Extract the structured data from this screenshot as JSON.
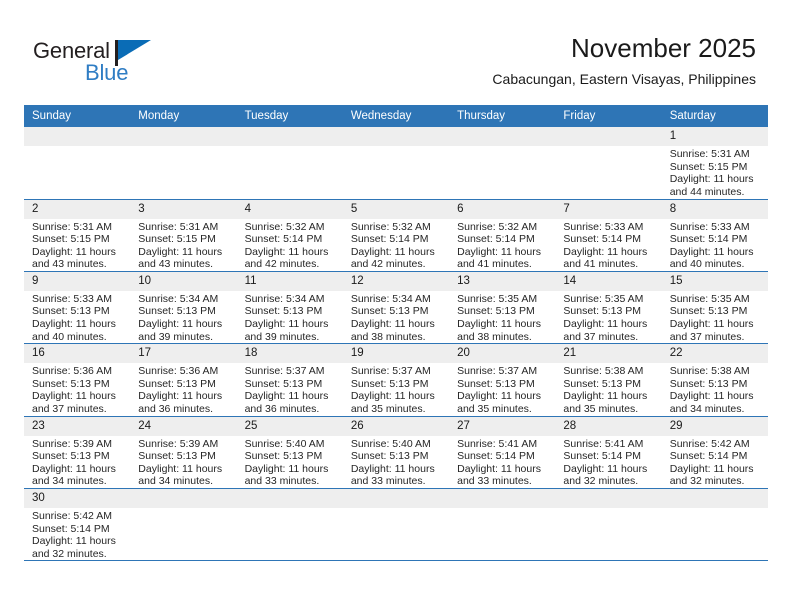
{
  "brand": {
    "name_dark": "General",
    "name_blue": "Blue",
    "flag_color": "#0a6cb6",
    "blue_text_color": "#2f7dc4"
  },
  "header": {
    "title": "November 2025",
    "subtitle": "Cabacungan, Eastern Visayas, Philippines"
  },
  "theme": {
    "header_bg": "#2e75b6",
    "header_text": "#ffffff",
    "daynum_band_bg": "#eeeeee",
    "row_divider": "#2e75b6",
    "body_text": "#262626"
  },
  "weekday_headers": [
    "Sunday",
    "Monday",
    "Tuesday",
    "Wednesday",
    "Thursday",
    "Friday",
    "Saturday"
  ],
  "weeks": [
    [
      {
        "empty": true
      },
      {
        "empty": true
      },
      {
        "empty": true
      },
      {
        "empty": true
      },
      {
        "empty": true
      },
      {
        "empty": true
      },
      {
        "day": "1",
        "sunrise": "Sunrise: 5:31 AM",
        "sunset": "Sunset: 5:15 PM",
        "daylight_line1": "Daylight: 11 hours",
        "daylight_line2": "and 44 minutes."
      }
    ],
    [
      {
        "day": "2",
        "sunrise": "Sunrise: 5:31 AM",
        "sunset": "Sunset: 5:15 PM",
        "daylight_line1": "Daylight: 11 hours",
        "daylight_line2": "and 43 minutes."
      },
      {
        "day": "3",
        "sunrise": "Sunrise: 5:31 AM",
        "sunset": "Sunset: 5:15 PM",
        "daylight_line1": "Daylight: 11 hours",
        "daylight_line2": "and 43 minutes."
      },
      {
        "day": "4",
        "sunrise": "Sunrise: 5:32 AM",
        "sunset": "Sunset: 5:14 PM",
        "daylight_line1": "Daylight: 11 hours",
        "daylight_line2": "and 42 minutes."
      },
      {
        "day": "5",
        "sunrise": "Sunrise: 5:32 AM",
        "sunset": "Sunset: 5:14 PM",
        "daylight_line1": "Daylight: 11 hours",
        "daylight_line2": "and 42 minutes."
      },
      {
        "day": "6",
        "sunrise": "Sunrise: 5:32 AM",
        "sunset": "Sunset: 5:14 PM",
        "daylight_line1": "Daylight: 11 hours",
        "daylight_line2": "and 41 minutes."
      },
      {
        "day": "7",
        "sunrise": "Sunrise: 5:33 AM",
        "sunset": "Sunset: 5:14 PM",
        "daylight_line1": "Daylight: 11 hours",
        "daylight_line2": "and 41 minutes."
      },
      {
        "day": "8",
        "sunrise": "Sunrise: 5:33 AM",
        "sunset": "Sunset: 5:14 PM",
        "daylight_line1": "Daylight: 11 hours",
        "daylight_line2": "and 40 minutes."
      }
    ],
    [
      {
        "day": "9",
        "sunrise": "Sunrise: 5:33 AM",
        "sunset": "Sunset: 5:13 PM",
        "daylight_line1": "Daylight: 11 hours",
        "daylight_line2": "and 40 minutes."
      },
      {
        "day": "10",
        "sunrise": "Sunrise: 5:34 AM",
        "sunset": "Sunset: 5:13 PM",
        "daylight_line1": "Daylight: 11 hours",
        "daylight_line2": "and 39 minutes."
      },
      {
        "day": "11",
        "sunrise": "Sunrise: 5:34 AM",
        "sunset": "Sunset: 5:13 PM",
        "daylight_line1": "Daylight: 11 hours",
        "daylight_line2": "and 39 minutes."
      },
      {
        "day": "12",
        "sunrise": "Sunrise: 5:34 AM",
        "sunset": "Sunset: 5:13 PM",
        "daylight_line1": "Daylight: 11 hours",
        "daylight_line2": "and 38 minutes."
      },
      {
        "day": "13",
        "sunrise": "Sunrise: 5:35 AM",
        "sunset": "Sunset: 5:13 PM",
        "daylight_line1": "Daylight: 11 hours",
        "daylight_line2": "and 38 minutes."
      },
      {
        "day": "14",
        "sunrise": "Sunrise: 5:35 AM",
        "sunset": "Sunset: 5:13 PM",
        "daylight_line1": "Daylight: 11 hours",
        "daylight_line2": "and 37 minutes."
      },
      {
        "day": "15",
        "sunrise": "Sunrise: 5:35 AM",
        "sunset": "Sunset: 5:13 PM",
        "daylight_line1": "Daylight: 11 hours",
        "daylight_line2": "and 37 minutes."
      }
    ],
    [
      {
        "day": "16",
        "sunrise": "Sunrise: 5:36 AM",
        "sunset": "Sunset: 5:13 PM",
        "daylight_line1": "Daylight: 11 hours",
        "daylight_line2": "and 37 minutes."
      },
      {
        "day": "17",
        "sunrise": "Sunrise: 5:36 AM",
        "sunset": "Sunset: 5:13 PM",
        "daylight_line1": "Daylight: 11 hours",
        "daylight_line2": "and 36 minutes."
      },
      {
        "day": "18",
        "sunrise": "Sunrise: 5:37 AM",
        "sunset": "Sunset: 5:13 PM",
        "daylight_line1": "Daylight: 11 hours",
        "daylight_line2": "and 36 minutes."
      },
      {
        "day": "19",
        "sunrise": "Sunrise: 5:37 AM",
        "sunset": "Sunset: 5:13 PM",
        "daylight_line1": "Daylight: 11 hours",
        "daylight_line2": "and 35 minutes."
      },
      {
        "day": "20",
        "sunrise": "Sunrise: 5:37 AM",
        "sunset": "Sunset: 5:13 PM",
        "daylight_line1": "Daylight: 11 hours",
        "daylight_line2": "and 35 minutes."
      },
      {
        "day": "21",
        "sunrise": "Sunrise: 5:38 AM",
        "sunset": "Sunset: 5:13 PM",
        "daylight_line1": "Daylight: 11 hours",
        "daylight_line2": "and 35 minutes."
      },
      {
        "day": "22",
        "sunrise": "Sunrise: 5:38 AM",
        "sunset": "Sunset: 5:13 PM",
        "daylight_line1": "Daylight: 11 hours",
        "daylight_line2": "and 34 minutes."
      }
    ],
    [
      {
        "day": "23",
        "sunrise": "Sunrise: 5:39 AM",
        "sunset": "Sunset: 5:13 PM",
        "daylight_line1": "Daylight: 11 hours",
        "daylight_line2": "and 34 minutes."
      },
      {
        "day": "24",
        "sunrise": "Sunrise: 5:39 AM",
        "sunset": "Sunset: 5:13 PM",
        "daylight_line1": "Daylight: 11 hours",
        "daylight_line2": "and 34 minutes."
      },
      {
        "day": "25",
        "sunrise": "Sunrise: 5:40 AM",
        "sunset": "Sunset: 5:13 PM",
        "daylight_line1": "Daylight: 11 hours",
        "daylight_line2": "and 33 minutes."
      },
      {
        "day": "26",
        "sunrise": "Sunrise: 5:40 AM",
        "sunset": "Sunset: 5:13 PM",
        "daylight_line1": "Daylight: 11 hours",
        "daylight_line2": "and 33 minutes."
      },
      {
        "day": "27",
        "sunrise": "Sunrise: 5:41 AM",
        "sunset": "Sunset: 5:14 PM",
        "daylight_line1": "Daylight: 11 hours",
        "daylight_line2": "and 33 minutes."
      },
      {
        "day": "28",
        "sunrise": "Sunrise: 5:41 AM",
        "sunset": "Sunset: 5:14 PM",
        "daylight_line1": "Daylight: 11 hours",
        "daylight_line2": "and 32 minutes."
      },
      {
        "day": "29",
        "sunrise": "Sunrise: 5:42 AM",
        "sunset": "Sunset: 5:14 PM",
        "daylight_line1": "Daylight: 11 hours",
        "daylight_line2": "and 32 minutes."
      }
    ],
    [
      {
        "day": "30",
        "sunrise": "Sunrise: 5:42 AM",
        "sunset": "Sunset: 5:14 PM",
        "daylight_line1": "Daylight: 11 hours",
        "daylight_line2": "and 32 minutes."
      },
      {
        "empty": true
      },
      {
        "empty": true
      },
      {
        "empty": true
      },
      {
        "empty": true
      },
      {
        "empty": true
      },
      {
        "empty": true
      }
    ]
  ]
}
